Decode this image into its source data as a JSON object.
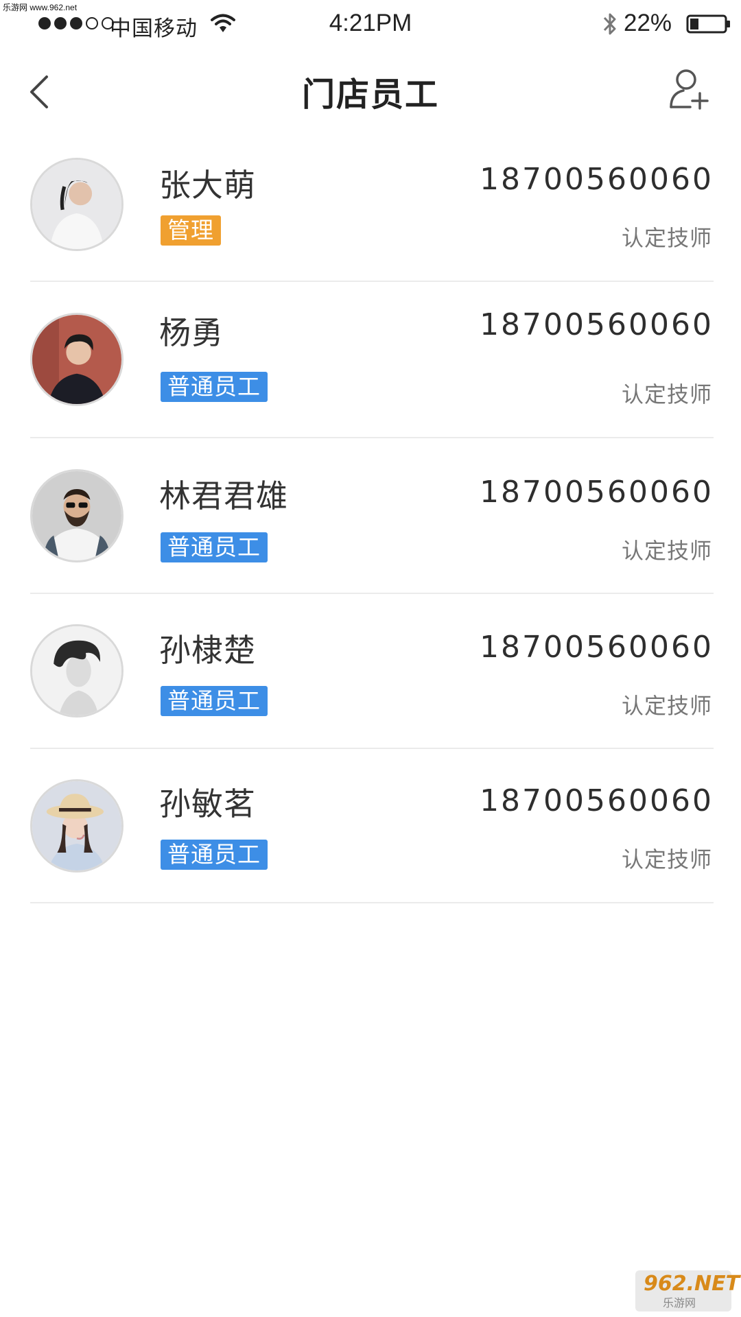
{
  "watermark": {
    "top_text": "乐游网 www.962.net",
    "logo_text": "962.NET",
    "logo_sub": "乐游网"
  },
  "status_bar": {
    "carrier": "中国移动",
    "time": "4:21PM",
    "battery": "22%",
    "signal_icon": "signal-dots-icon",
    "wifi_icon": "wifi-icon",
    "bluetooth_icon": "bluetooth-icon",
    "battery_icon": "battery-icon"
  },
  "nav": {
    "title": "门店员工",
    "back_icon": "chevron-left-icon",
    "add_icon": "add-user-icon"
  },
  "colors": {
    "admin_badge": "#f0a030",
    "staff_badge": "#3d8ee6",
    "text_primary": "#333333",
    "text_secondary": "#777777",
    "divider": "#ebebeb"
  },
  "employees": [
    {
      "name": "张大萌",
      "role": "管理",
      "role_type": "admin",
      "phone": "18700560060",
      "cert": "认定技师"
    },
    {
      "name": "杨勇",
      "role": "普通员工",
      "role_type": "staff",
      "phone": "18700560060",
      "cert": "认定技师"
    },
    {
      "name": "林君君雄",
      "role": "普通员工",
      "role_type": "staff",
      "phone": "18700560060",
      "cert": "认定技师"
    },
    {
      "name": "孙棣楚",
      "role": "普通员工",
      "role_type": "staff",
      "phone": "18700560060",
      "cert": "认定技师"
    },
    {
      "name": "孙敏茗",
      "role": "普通员工",
      "role_type": "staff",
      "phone": "18700560060",
      "cert": "认定技师"
    }
  ]
}
